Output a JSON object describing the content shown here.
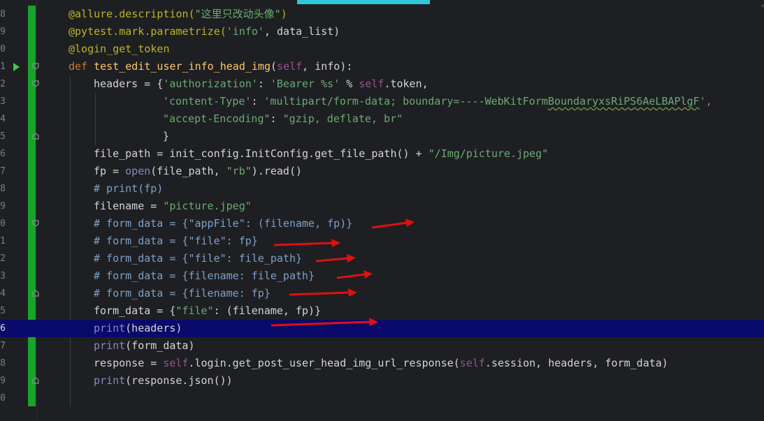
{
  "editor": {
    "current_line_index": 15,
    "lines": [
      {
        "num": "8",
        "fold": false,
        "run": false
      },
      {
        "num": "9",
        "fold": false,
        "run": false
      },
      {
        "num": "0",
        "fold": false,
        "run": false
      },
      {
        "num": "1",
        "fold": true,
        "run": true
      },
      {
        "num": "2",
        "fold": true,
        "run": false
      },
      {
        "num": "3",
        "fold": false,
        "run": false
      },
      {
        "num": "4",
        "fold": false,
        "run": false
      },
      {
        "num": "5",
        "fold": true,
        "run": false
      },
      {
        "num": "6",
        "fold": false,
        "run": false
      },
      {
        "num": "7",
        "fold": false,
        "run": false
      },
      {
        "num": "8",
        "fold": false,
        "run": false
      },
      {
        "num": "9",
        "fold": false,
        "run": false
      },
      {
        "num": "0",
        "fold": true,
        "run": false
      },
      {
        "num": "1",
        "fold": false,
        "run": false
      },
      {
        "num": "2",
        "fold": false,
        "run": false
      },
      {
        "num": "3",
        "fold": false,
        "run": false
      },
      {
        "num": "4",
        "fold": true,
        "run": false
      },
      {
        "num": "5",
        "fold": false,
        "run": false
      },
      {
        "num": "6",
        "fold": false,
        "run": false
      },
      {
        "num": "7",
        "fold": false,
        "run": false
      },
      {
        "num": "8",
        "fold": false,
        "run": false
      },
      {
        "num": "9",
        "fold": true,
        "run": false
      },
      {
        "num": "0",
        "fold": false,
        "run": false
      }
    ],
    "tokens": {
      "l0": [
        "@allure.description(",
        "\"这里只改动头像\"",
        ")"
      ],
      "l1": [
        "@pytest.mark.parametrize(",
        "'info'",
        ", data_list)"
      ],
      "l2": [
        "@login_get_token"
      ],
      "l3": [
        "def ",
        "test_edit_user_info_head_img",
        "(",
        "self",
        ", info):"
      ],
      "l4": [
        "headers = {",
        "'authorization'",
        ": ",
        "'Bearer %s'",
        " % ",
        "self",
        ".token,"
      ],
      "l5": [
        "'content-Type'",
        ": ",
        "'multipart/form-data; boundary=----WebKitForm",
        "BoundaryxsRiPS6AeLBAPlgF",
        "'",
        ","
      ],
      "l6": [
        "\"accept-Encoding\"",
        ": ",
        "\"gzip, deflate, br\""
      ],
      "l7": [
        "}"
      ],
      "l8": [
        "file_path = init_config.InitConfig.get_file_path() + ",
        "\"/Img/picture.jpeg\""
      ],
      "l9": [
        "fp = ",
        "open",
        "(file_path, ",
        "\"rb\"",
        ").read()"
      ],
      "l10": [
        "# print(fp)"
      ],
      "l11": [
        "filename = ",
        "\"picture.jpeg\""
      ],
      "l12": [
        "# form_data = {\"appFile\": (filename, fp)}"
      ],
      "l13": [
        "# form_data = {\"file\": fp}"
      ],
      "l14": [
        "# form_data = {\"file\": file_path}"
      ],
      "l15": [
        "# form_data = {filename: file_path}"
      ],
      "l16": [
        "# form_data = {filename: fp}"
      ],
      "l17": [
        "form_data = {",
        "\"file\"",
        ": (filename, fp)}"
      ],
      "l18": [
        "print",
        "(headers)"
      ],
      "l19": [
        "print",
        "(form_data)"
      ],
      "l20": [
        "response = ",
        "self",
        ".login.get_post_user_head_img_url_response(",
        "self",
        ".session, headers, form_data)"
      ],
      "l21": [
        "print",
        "(response.json())"
      ]
    }
  },
  "colors": {
    "background": "#1e1f22",
    "current_line": "#0a0a6b",
    "vcs_added": "#16a52a",
    "annotation_arrow": "#e01010",
    "tab_accent": "#2fc8d8"
  },
  "icons": {
    "run_gutter": "run-triangle-icon",
    "fold_marker": "fold-pentagon-icon",
    "annotations": "red-arrow-icon"
  }
}
